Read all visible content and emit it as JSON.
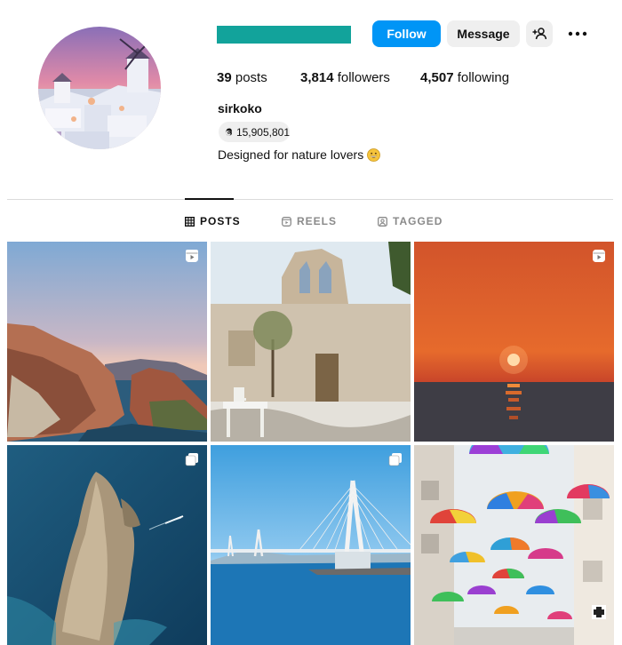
{
  "profile": {
    "full_name": "sirkoko",
    "bio": "Designed for nature lovers",
    "bio_emoji": "grinning-face-emoji",
    "threads_count": "15,905,801",
    "threads_icon": "threads-icon"
  },
  "actions": {
    "follow_label": "Follow",
    "message_label": "Message",
    "add_user_icon": "add-user-icon",
    "more_icon": "more-options-icon"
  },
  "stats": {
    "posts_count": "39",
    "posts_label": "posts",
    "followers_count": "3,814",
    "followers_label": "followers",
    "following_count": "4,507",
    "following_label": "following"
  },
  "tabs": [
    {
      "label": "POSTS",
      "icon": "grid-icon",
      "active": true
    },
    {
      "label": "REELS",
      "icon": "reels-icon",
      "active": false
    },
    {
      "label": "TAGGED",
      "icon": "tagged-icon",
      "active": false
    }
  ],
  "colors": {
    "follow_button": "#0095f6",
    "username_redaction": "#12a39b",
    "secondary_button": "#efefef"
  },
  "posts": [
    {
      "subject": "coastal cliffs at sunset",
      "badge": "reel-icon"
    },
    {
      "subject": "whitewashed chapel ruin with courtyard table",
      "badge": null
    },
    {
      "subject": "orange sunset over the sea",
      "badge": "reel-icon"
    },
    {
      "subject": "rock island in turquoise water",
      "badge": "carousel-icon"
    },
    {
      "subject": "cable-stayed bridge over the sea",
      "badge": "carousel-icon"
    },
    {
      "subject": "rainbow umbrellas over a street",
      "badge": null
    }
  ]
}
